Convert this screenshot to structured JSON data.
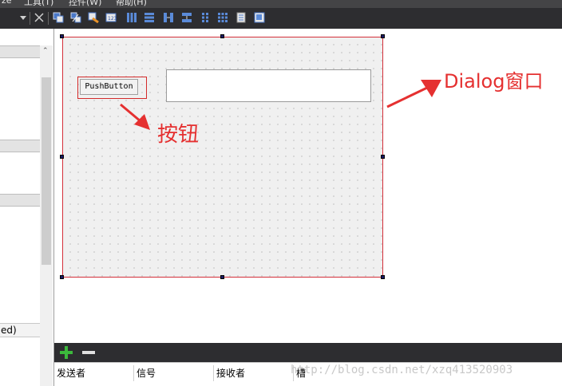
{
  "menubar": {
    "items": [
      "ze",
      "工具(T)",
      "控件(W)",
      "帮助(H)"
    ]
  },
  "toolbar": {
    "icons": [
      "dropdown-icon",
      "close-icon",
      "edit-widgets-icon",
      "edit-signals-icon",
      "edit-buddies-icon",
      "edit-tab-order-icon",
      "layout-horizontal-icon",
      "layout-vertical-icon",
      "splitter-horizontal-icon",
      "splitter-vertical-icon",
      "layout-form-icon",
      "layout-grid-icon",
      "break-layout-icon",
      "adjust-size-icon"
    ]
  },
  "leftpane": {
    "bottom_text": "ed)"
  },
  "form": {
    "pushbutton_label": "PushButton"
  },
  "annotations": {
    "button": "按钮",
    "dialog": "Dialog窗口"
  },
  "colors": {
    "annotation_red": "#e53030",
    "toolbar_dark": "#2d2d30",
    "form_border": "#d4303a"
  },
  "signal_slot_editor": {
    "columns": [
      "发送者",
      "信号",
      "接收者",
      "槽"
    ]
  },
  "watermark": "http://blog.csdn.net/xzq413520903"
}
